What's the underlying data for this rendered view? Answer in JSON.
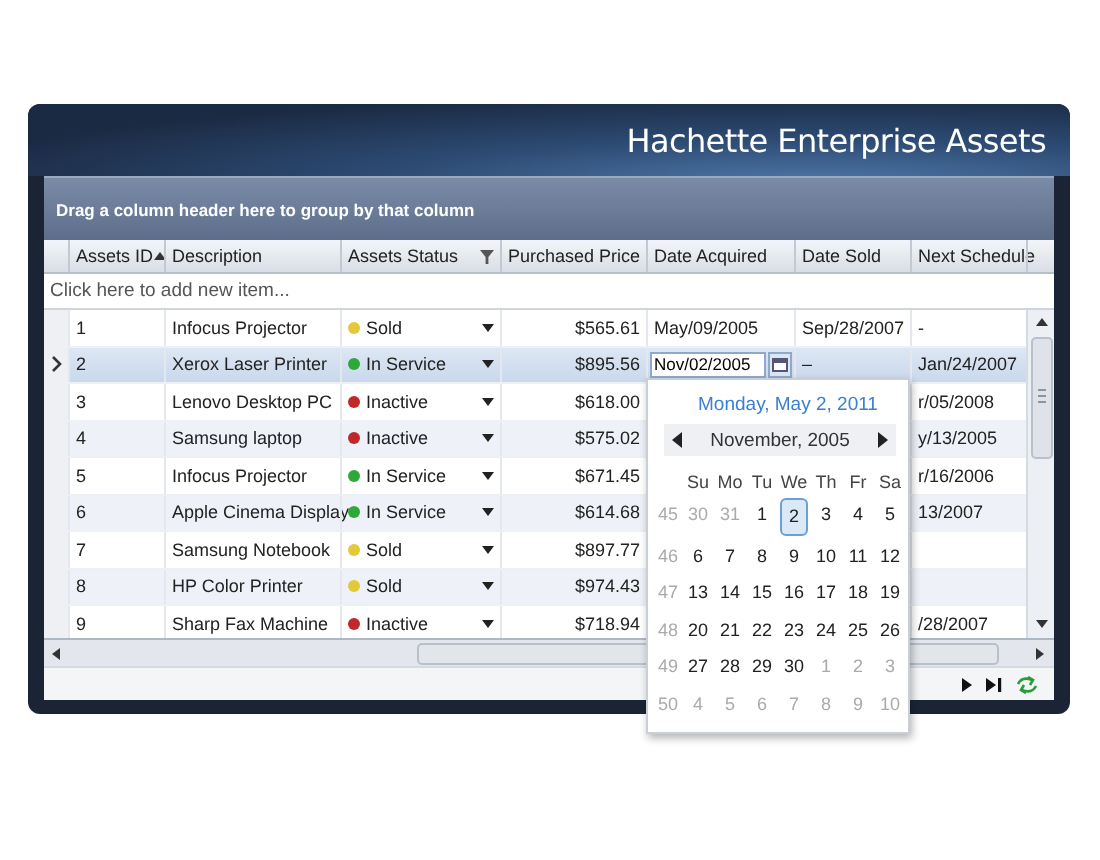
{
  "header": {
    "title": "Hachette Enterprise Assets"
  },
  "group_panel": {
    "text": "Drag a column header here to group by that column"
  },
  "columns": [
    {
      "label": "Assets ID",
      "sorted": true,
      "filterable": false
    },
    {
      "label": "Description",
      "sorted": false,
      "filterable": false
    },
    {
      "label": "Assets Status",
      "sorted": false,
      "filterable": true
    },
    {
      "label": "Purchased Price",
      "sorted": false,
      "filterable": false
    },
    {
      "label": "Date Acquired",
      "sorted": false,
      "filterable": false
    },
    {
      "label": "Date Sold",
      "sorted": false,
      "filterable": false
    },
    {
      "label": "Next Schedule",
      "sorted": false,
      "filterable": false
    }
  ],
  "new_row": {
    "text": "Click here to add new item..."
  },
  "rows": [
    {
      "id": "1",
      "description": "Infocus Projector",
      "status": {
        "label": "Sold",
        "color": "#e2c93a"
      },
      "price": "$565.61",
      "date_acquired": "May/09/2005",
      "date_sold": "Sep/28/2007",
      "next_schedule": "-",
      "selected": false,
      "editing": false
    },
    {
      "id": "2",
      "description": "Xerox Laser Printer",
      "status": {
        "label": "In Service",
        "color": "#2fa83a"
      },
      "price": "$895.56",
      "date_acquired": "Nov/02/2005",
      "date_sold": "–",
      "next_schedule": "Jan/24/2007",
      "selected": true,
      "editing": true
    },
    {
      "id": "3",
      "description": "Lenovo Desktop PC",
      "status": {
        "label": "Inactive",
        "color": "#c0282a"
      },
      "price": "$618.00",
      "next_schedule": "r/05/2008",
      "selected": false,
      "editing": false
    },
    {
      "id": "4",
      "description": "Samsung laptop",
      "status": {
        "label": "Inactive",
        "color": "#c0282a"
      },
      "price": "$575.02",
      "next_schedule": "y/13/2005",
      "selected": false,
      "editing": false
    },
    {
      "id": "5",
      "description": "Infocus Projector",
      "status": {
        "label": "In Service",
        "color": "#2fa83a"
      },
      "price": "$671.45",
      "next_schedule": "r/16/2006",
      "selected": false,
      "editing": false
    },
    {
      "id": "6",
      "description": "Apple Cinema Display",
      "status": {
        "label": "In Service",
        "color": "#2fa83a"
      },
      "price": "$614.68",
      "next_schedule": "13/2007",
      "selected": false,
      "editing": false
    },
    {
      "id": "7",
      "description": "Samsung Notebook",
      "status": {
        "label": "Sold",
        "color": "#e2c93a"
      },
      "price": "$897.77",
      "selected": false,
      "editing": false
    },
    {
      "id": "8",
      "description": "HP Color Printer",
      "status": {
        "label": "Sold",
        "color": "#e2c93a"
      },
      "price": "$974.43",
      "selected": false,
      "editing": false
    },
    {
      "id": "9",
      "description": "Sharp Fax Machine",
      "status": {
        "label": "Inactive",
        "color": "#c0282a"
      },
      "price": "$718.94",
      "next_schedule": "/28/2007",
      "selected": false,
      "editing": false
    }
  ],
  "calendar": {
    "today": "Monday, May 2, 2011",
    "month": "November, 2005",
    "weekdays": [
      "Su",
      "Mo",
      "Tu",
      "We",
      "Th",
      "Fr",
      "Sa"
    ],
    "weeks": [
      {
        "number": "45",
        "days": [
          {
            "day": "30",
            "other_month": true,
            "selected": false
          },
          {
            "day": "31",
            "other_month": true,
            "selected": false
          },
          {
            "day": "1",
            "other_month": false,
            "selected": false
          },
          {
            "day": "2",
            "other_month": false,
            "selected": true
          },
          {
            "day": "3",
            "other_month": false,
            "selected": false
          },
          {
            "day": "4",
            "other_month": false,
            "selected": false
          },
          {
            "day": "5",
            "other_month": false,
            "selected": false
          }
        ]
      },
      {
        "number": "46",
        "days": [
          {
            "day": "6",
            "other_month": false,
            "selected": false
          },
          {
            "day": "7",
            "other_month": false,
            "selected": false
          },
          {
            "day": "8",
            "other_month": false,
            "selected": false
          },
          {
            "day": "9",
            "other_month": false,
            "selected": false
          },
          {
            "day": "10",
            "other_month": false,
            "selected": false
          },
          {
            "day": "11",
            "other_month": false,
            "selected": false
          },
          {
            "day": "12",
            "other_month": false,
            "selected": false
          }
        ]
      },
      {
        "number": "47",
        "days": [
          {
            "day": "13",
            "other_month": false,
            "selected": false
          },
          {
            "day": "14",
            "other_month": false,
            "selected": false
          },
          {
            "day": "15",
            "other_month": false,
            "selected": false
          },
          {
            "day": "16",
            "other_month": false,
            "selected": false
          },
          {
            "day": "17",
            "other_month": false,
            "selected": false
          },
          {
            "day": "18",
            "other_month": false,
            "selected": false
          },
          {
            "day": "19",
            "other_month": false,
            "selected": false
          }
        ]
      },
      {
        "number": "48",
        "days": [
          {
            "day": "20",
            "other_month": false,
            "selected": false
          },
          {
            "day": "21",
            "other_month": false,
            "selected": false
          },
          {
            "day": "22",
            "other_month": false,
            "selected": false
          },
          {
            "day": "23",
            "other_month": false,
            "selected": false
          },
          {
            "day": "24",
            "other_month": false,
            "selected": false
          },
          {
            "day": "25",
            "other_month": false,
            "selected": false
          },
          {
            "day": "26",
            "other_month": false,
            "selected": false
          }
        ]
      },
      {
        "number": "49",
        "days": [
          {
            "day": "27",
            "other_month": false,
            "selected": false
          },
          {
            "day": "28",
            "other_month": false,
            "selected": false
          },
          {
            "day": "29",
            "other_month": false,
            "selected": false
          },
          {
            "day": "30",
            "other_month": false,
            "selected": false
          },
          {
            "day": "1",
            "other_month": true,
            "selected": false
          },
          {
            "day": "2",
            "other_month": true,
            "selected": false
          },
          {
            "day": "3",
            "other_month": true,
            "selected": false
          }
        ]
      },
      {
        "number": "50",
        "days": [
          {
            "day": "4",
            "other_month": true,
            "selected": false
          },
          {
            "day": "5",
            "other_month": true,
            "selected": false
          },
          {
            "day": "6",
            "other_month": true,
            "selected": false
          },
          {
            "day": "7",
            "other_month": true,
            "selected": false
          },
          {
            "day": "8",
            "other_month": true,
            "selected": false
          },
          {
            "day": "9",
            "other_month": true,
            "selected": false
          },
          {
            "day": "10",
            "other_month": true,
            "selected": false
          }
        ]
      }
    ]
  }
}
